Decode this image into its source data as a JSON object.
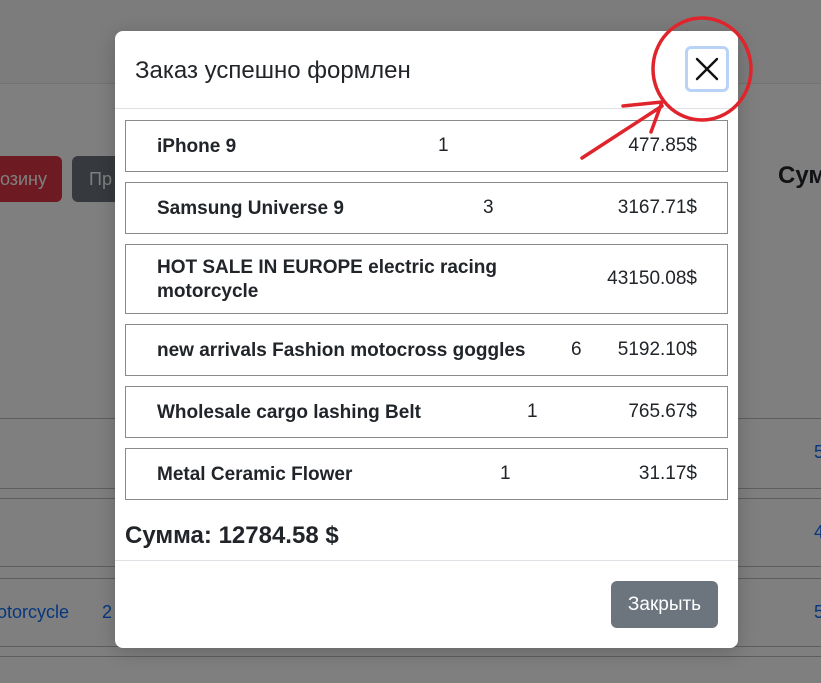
{
  "background": {
    "red_button_label": "озину",
    "gray_button_label": "Пр",
    "sum_label": "Сум",
    "link_text": "otorcycle",
    "link_number": "2",
    "right_marks": [
      "5",
      "4",
      "5"
    ]
  },
  "modal": {
    "title": "Заказ успешно формлен",
    "items": [
      {
        "name": "iPhone 9",
        "quantity": "1",
        "price": "477.85$"
      },
      {
        "name": "Samsung Universe 9",
        "quantity": "3",
        "price": "3167.71$"
      },
      {
        "name": "HOT SALE IN EUROPE electric racing motorcycle",
        "quantity": "",
        "price": "43150.08$"
      },
      {
        "name": "new arrivals Fashion motocross goggles",
        "quantity": "6",
        "price": "5192.10$"
      },
      {
        "name": "Wholesale cargo lashing Belt",
        "quantity": "1",
        "price": "765.67$"
      },
      {
        "name": "Metal Ceramic Flower",
        "quantity": "1",
        "price": "31.17$"
      }
    ],
    "total": "Сумма: 12784.58 $",
    "close_button_label": "Закрыть",
    "close_icon": "close-icon"
  },
  "colors": {
    "annotation": "#e0242c",
    "button_secondary": "#6c757d",
    "button_danger": "#dc3545",
    "link": "#0d6efd"
  }
}
